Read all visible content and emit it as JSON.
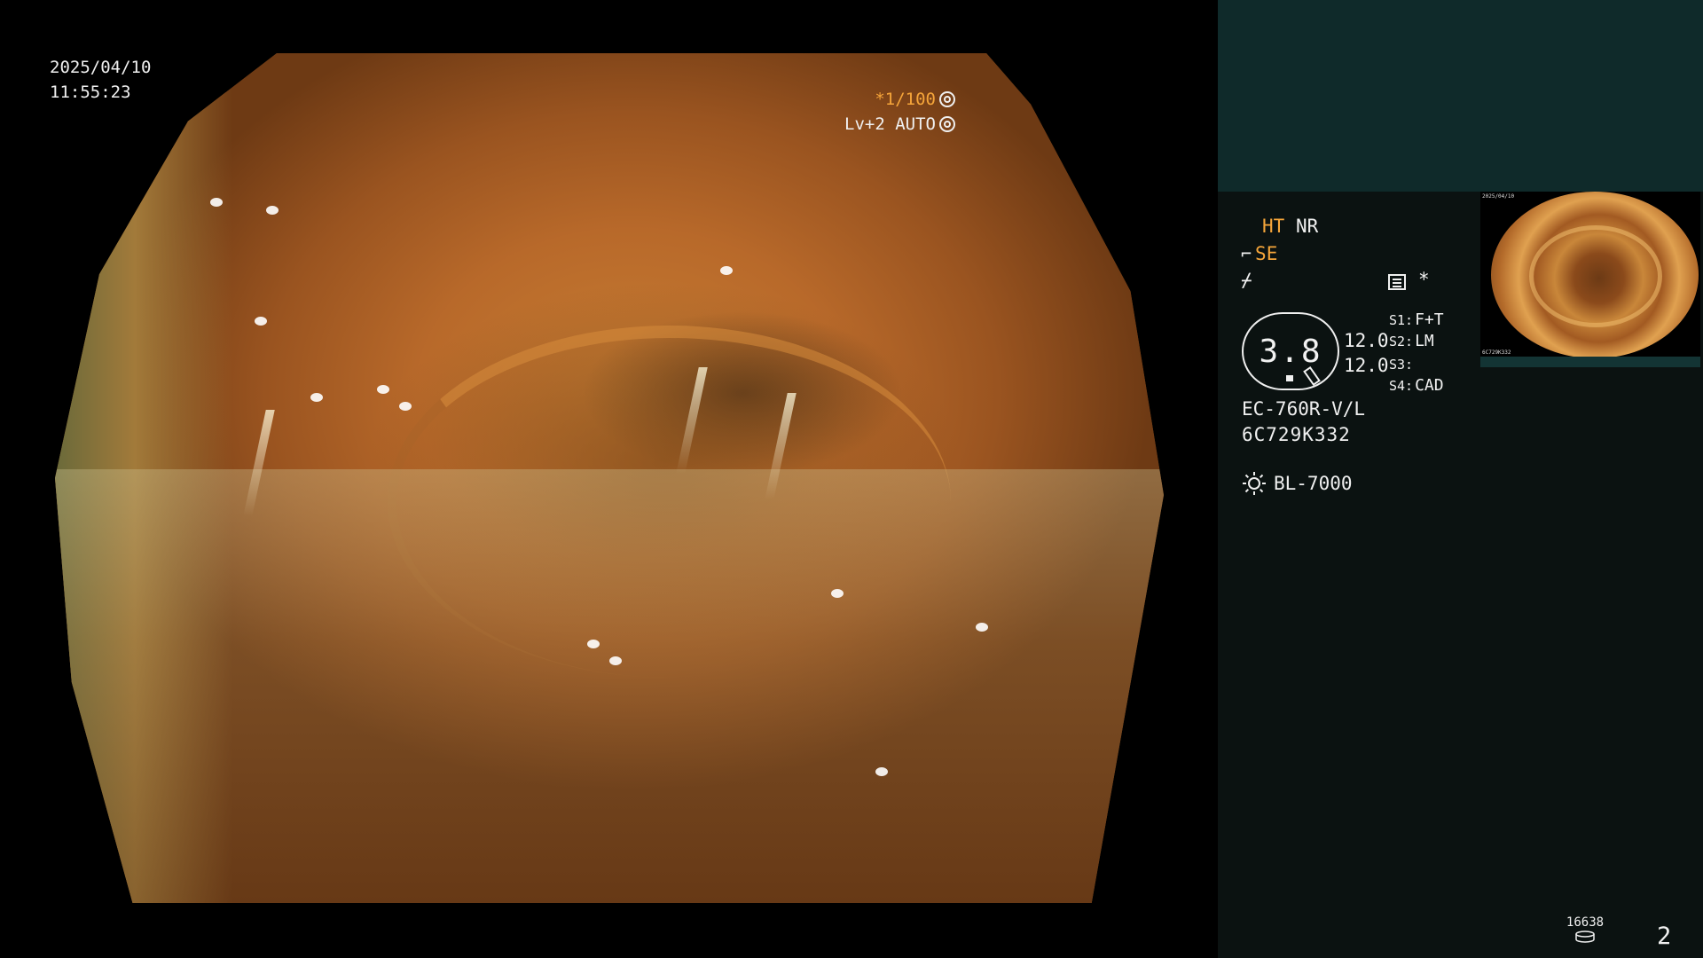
{
  "overlay": {
    "date": "2025/04/10",
    "time": "11:55:23",
    "shutter": "*1/100",
    "level": "Lv+2 AUTO"
  },
  "panel": {
    "ht": "HT",
    "nr": "NR",
    "se": "SE",
    "flag": "⌿",
    "star": "*",
    "zoom": "3.8",
    "gain_top": "12.0",
    "gain_bottom": "12.0",
    "s1_key": "S1:",
    "s1_val": "F+T",
    "s2_key": "S2:",
    "s2_val": "LM",
    "s3_key": "S3:",
    "s3_val": "",
    "s4_key": "S4:",
    "s4_val": "CAD",
    "scope_model": "EC-760R-V/L",
    "scope_serial": "6C729K332",
    "light_source": "BL-7000"
  },
  "thumbnail": {
    "mini_date": "2025/04/10",
    "mini_serial": "6C729K332"
  },
  "footer": {
    "counter": "16638",
    "page": "2"
  },
  "colors": {
    "accent": "#f5a53a",
    "panel_bg": "#0b1211",
    "panel_top_bg": "#0f2a2a"
  },
  "icons": [
    "shutter-icon",
    "auto-icon",
    "scope-tip-icon",
    "menu-icon",
    "light-source-icon",
    "storage-disk-icon"
  ]
}
